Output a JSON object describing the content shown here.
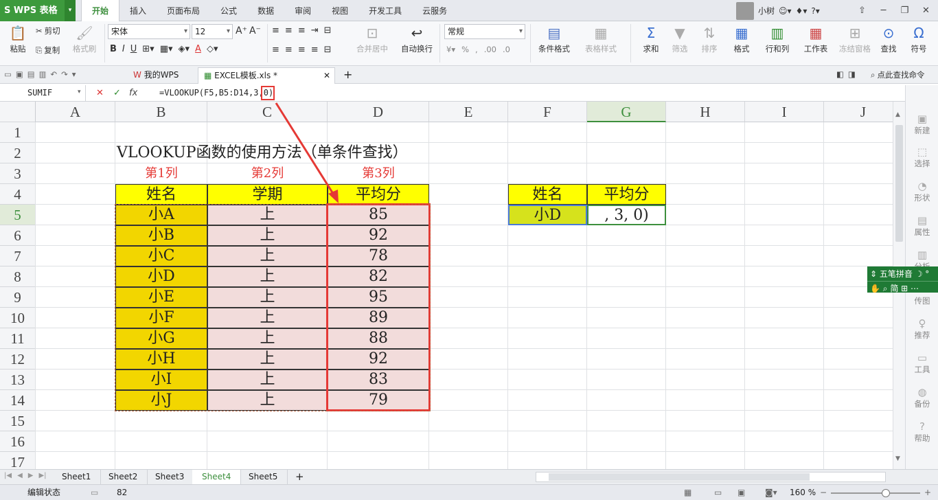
{
  "app": {
    "logo": "WPS 表格",
    "tabs": [
      "开始",
      "插入",
      "页面布局",
      "公式",
      "数据",
      "审阅",
      "视图",
      "开发工具",
      "云服务"
    ],
    "active_tab": "开始",
    "user": "小树",
    "win_buttons": [
      "─",
      "❐",
      "✕"
    ]
  },
  "ribbon": {
    "paste": "粘贴",
    "cut": "剪切",
    "copy": "复制",
    "format_painter": "格式刷",
    "font": "宋体",
    "size": "12",
    "merge": "合并居中",
    "wrap": "自动换行",
    "number_format": "常规",
    "cond_format": "条件格式",
    "table_style": "表格样式",
    "sum": "求和",
    "filter": "筛选",
    "sort": "排序",
    "format": "格式",
    "rowcol": "行和列",
    "worksheet": "工作表",
    "freeze": "冻结窗格",
    "find": "查找",
    "symbol": "符号",
    "percent": "%",
    "comma": ","
  },
  "doc_tabs": {
    "home": "我的WPS",
    "file": "EXCEL模板.xls *",
    "add": "+",
    "search": "点此查找命令"
  },
  "formula_bar": {
    "name_box": "SUMIF",
    "fx": "fx",
    "formula": "=VLOOKUP(F5,B5:D14,3,0)",
    "cancel": "✕",
    "confirm": "✓"
  },
  "columns": [
    "A",
    "B",
    "C",
    "D",
    "E",
    "F",
    "G",
    "H",
    "I",
    "J"
  ],
  "rows": [
    "1",
    "2",
    "3",
    "4",
    "5",
    "6",
    "7",
    "8",
    "9",
    "10",
    "11",
    "12",
    "13",
    "14",
    "15",
    "16",
    "17"
  ],
  "sheet": {
    "title": "VLOOKUP函数的使用方法（单条件查找）",
    "col_notes": [
      "第1列",
      "第2列",
      "第3列"
    ],
    "headers": [
      "姓名",
      "学期",
      "平均分"
    ],
    "data": [
      [
        "小A",
        "上",
        "85"
      ],
      [
        "小B",
        "上",
        "92"
      ],
      [
        "小C",
        "上",
        "78"
      ],
      [
        "小D",
        "上",
        "82"
      ],
      [
        "小E",
        "上",
        "95"
      ],
      [
        "小F",
        "上",
        "89"
      ],
      [
        "小G",
        "上",
        "88"
      ],
      [
        "小H",
        "上",
        "92"
      ],
      [
        "小I",
        "上",
        "83"
      ],
      [
        "小J",
        "上",
        "79"
      ]
    ],
    "lookup_headers": [
      "姓名",
      "平均分"
    ],
    "lookup_name": "小D",
    "lookup_editing": ", 3, 0)"
  },
  "sheet_tabs": [
    "Sheet1",
    "Sheet2",
    "Sheet3",
    "Sheet4",
    "Sheet5"
  ],
  "active_sheet": "Sheet4",
  "status": {
    "mode": "编辑状态",
    "count": "82",
    "zoom": "160 %"
  },
  "right_panel": [
    "新建",
    "选择",
    "形状",
    "属性",
    "分析",
    "传图",
    "推荐",
    "工具",
    "备份",
    "帮助"
  ],
  "ime": {
    "line1": "五笔拼音",
    "line2": "简"
  },
  "colors": {
    "yellow": "#ffff00",
    "gold": "#f2d600",
    "pink": "#f2dcdb",
    "red": "#e53935",
    "green": "#3d8f3d",
    "lookup_fill": "#d6e21c"
  }
}
